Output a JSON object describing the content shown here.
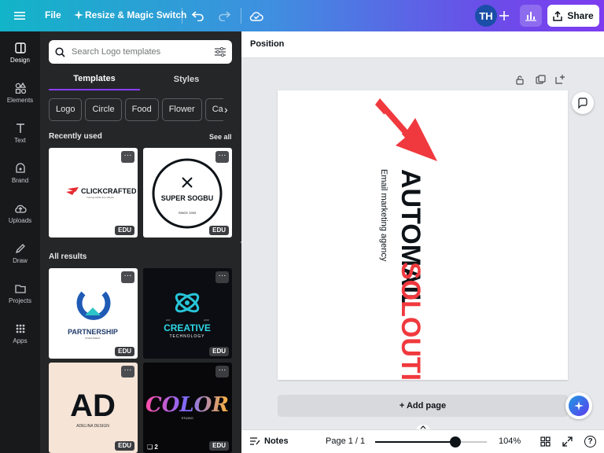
{
  "topbar": {
    "file": "File",
    "resize": "Resize & Magic Switch",
    "avatar": "TH",
    "share": "Share"
  },
  "rail": {
    "items": [
      {
        "label": "Design",
        "icon": "design-icon"
      },
      {
        "label": "Elements",
        "icon": "elements-icon"
      },
      {
        "label": "Text",
        "icon": "text-icon"
      },
      {
        "label": "Brand",
        "icon": "brand-icon"
      },
      {
        "label": "Uploads",
        "icon": "uploads-icon"
      },
      {
        "label": "Draw",
        "icon": "draw-icon"
      },
      {
        "label": "Projects",
        "icon": "projects-icon"
      },
      {
        "label": "Apps",
        "icon": "apps-icon"
      }
    ]
  },
  "panel": {
    "search_placeholder": "Search Logo templates",
    "tabs": [
      "Templates",
      "Styles"
    ],
    "chips": [
      "Logo",
      "Circle",
      "Food",
      "Flower",
      "Ca"
    ],
    "recently_used": "Recently used",
    "see_all": "See all",
    "all_results": "All results",
    "recent": [
      {
        "title": "CLICKCRAFTED",
        "subtitle": "Turning Clicks Into Clients",
        "badge": "EDU"
      },
      {
        "title": "SUPER SOGBU",
        "subtitle": "SINCE 1993",
        "badge": "EDU"
      }
    ],
    "results": [
      {
        "title": "PARTNERSHIP",
        "subtitle": "INVESTMENT",
        "badge": "EDU"
      },
      {
        "title": "CREATIVE",
        "subtitle": "TECHNOLOGY",
        "est": "EST",
        "year": "2028",
        "badge": "EDU"
      },
      {
        "title": "AD",
        "subtitle": "ADELINA DESIGN",
        "badge": "EDU"
      },
      {
        "title": "COLOR",
        "subtitle": "STUDIO",
        "count": "2",
        "badge": "EDU"
      }
    ]
  },
  "editor": {
    "position": "Position",
    "design": {
      "line1": "AUTOMAIL",
      "line2": "SOLOUTIONS",
      "tagline": "Email marketing agency"
    },
    "add_page": "+ Add page",
    "notes": "Notes",
    "page_indicator": "Page 1 / 1",
    "zoom": "104%",
    "zoom_level": 0.72
  },
  "colors": {
    "accent": "#8b3dff",
    "brand_red": "#f0393e"
  }
}
